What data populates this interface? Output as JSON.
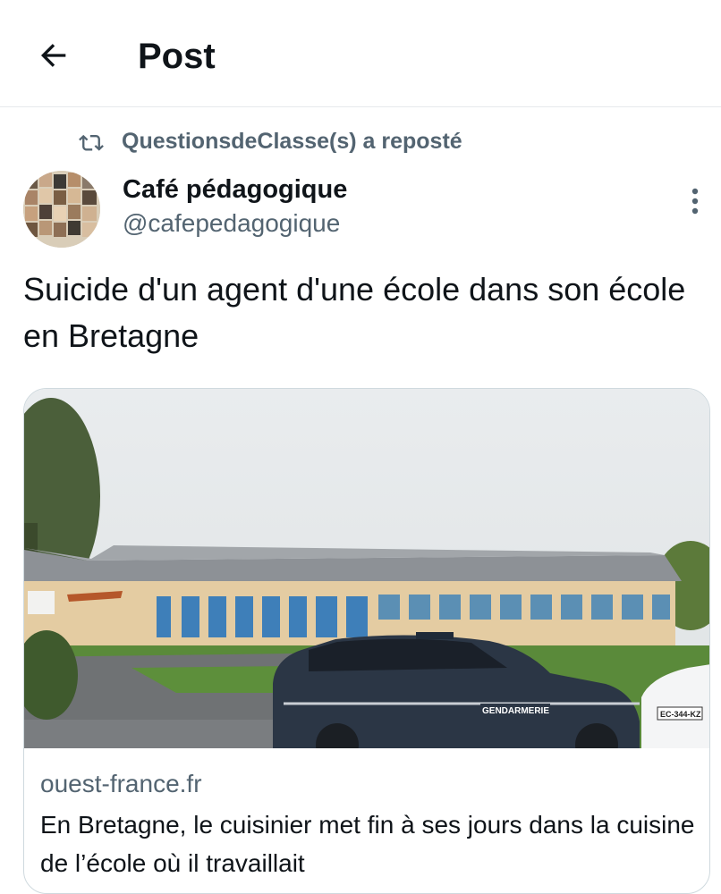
{
  "header": {
    "title": "Post",
    "back_icon": "arrow-left-icon"
  },
  "repost": {
    "text": "QuestionsdeClasse(s) a reposté",
    "icon": "retweet-icon"
  },
  "author": {
    "name": "Café pédagogique",
    "handle": "@cafepedagogique"
  },
  "tweet": {
    "text": "Suicide d'un agent d'une école dans son école en Bretagne"
  },
  "card": {
    "domain": "ouest-france.fr",
    "title": "En Bretagne, le cuisinier met fin à ses jours dans la cuisine de l’école où il travaillait",
    "car_label": "GENDARMERIE",
    "plate": "EC-344-KZ"
  },
  "colors": {
    "text": "#0f1419",
    "muted": "#536471",
    "border": "#cfd9de"
  }
}
